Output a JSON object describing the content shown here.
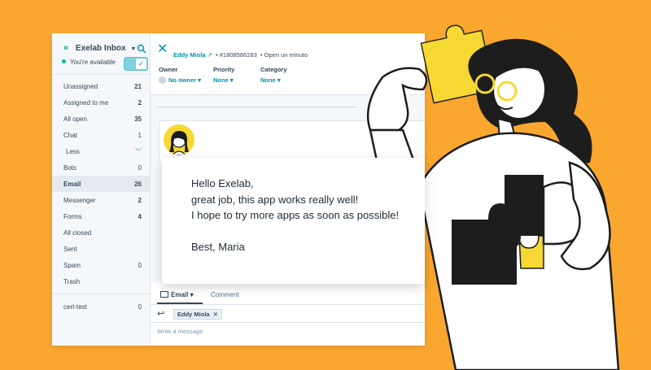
{
  "sidebar": {
    "inbox_name": "Exelab Inbox",
    "availability": "You're available",
    "items": [
      {
        "label": "Unassigned",
        "count": "21",
        "bold": true
      },
      {
        "label": "Assigned to me",
        "count": "2",
        "bold": true
      },
      {
        "label": "All open",
        "count": "35",
        "bold": true
      },
      {
        "label": "Chat",
        "count": "1",
        "bold": false
      },
      {
        "label": "Less",
        "count": "",
        "bold": false
      },
      {
        "label": "Bots",
        "count": "0",
        "bold": false
      },
      {
        "label": "Email",
        "count": "26",
        "bold": true
      },
      {
        "label": "Messenger",
        "count": "2",
        "bold": true
      },
      {
        "label": "Forms",
        "count": "4",
        "bold": true
      },
      {
        "label": "All closed",
        "count": "",
        "bold": false
      },
      {
        "label": "Sent",
        "count": "",
        "bold": false
      },
      {
        "label": "Spam",
        "count": "0",
        "bold": false
      },
      {
        "label": "Trash",
        "count": "",
        "bold": false
      }
    ],
    "bottom_item": {
      "label": "cert-test",
      "count": "0"
    }
  },
  "ticket": {
    "contact_name": "Eddy Miola",
    "ticket_id": "#1808586283",
    "status": "Open un minuto"
  },
  "properties": {
    "owner_label": "Owner",
    "owner_value": "No owner",
    "priority_label": "Priority",
    "priority_value": "None",
    "category_label": "Category",
    "category_value": "None"
  },
  "reply": {
    "tab_email": "Email",
    "tab_comment": "Comment",
    "recipient": "Eddy Miola",
    "placeholder": "Write a message"
  },
  "bubble": {
    "lines": [
      "Hello Exelab,",
      "great job, this app works really well!",
      "I hope to try more apps as soon as possible!",
      "",
      "Best, Maria"
    ]
  },
  "colors": {
    "background": "#f9a72f",
    "accent": "#0091ae",
    "illustration_yellow": "#f5d832",
    "text_dark": "#33475b"
  }
}
